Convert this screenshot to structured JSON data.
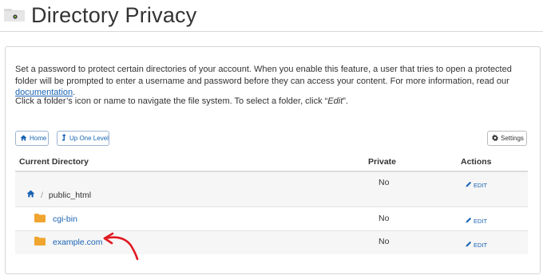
{
  "header": {
    "title": "Directory Privacy",
    "icon": "folder-eye-icon"
  },
  "description": {
    "text": "Set a password to protect certain directories of your account. When you enable this feature, a user that tries to open a protected folder will be prompted to enter a username and password before they can access your content. For more information, read our ",
    "link_label": "documentation",
    "text_end": "."
  },
  "instruction": {
    "text": "Click a folder’s icon or name to navigate the file system. To select a folder, click “",
    "emphasis": "Edit",
    "text_end": "”."
  },
  "toolbar": {
    "home_label": "Home",
    "home_icon": "home-icon",
    "up_label": "Up One Level",
    "up_icon": "level-up-icon",
    "settings_label": "Settings",
    "settings_icon": "gear-icon"
  },
  "table": {
    "headers": {
      "directory": "Current Directory",
      "private": "Private",
      "actions": "Actions"
    },
    "current": {
      "separator": "/",
      "path": "public_html",
      "private": "No",
      "action": "EDIT"
    },
    "rows": [
      {
        "name": "cgi-bin",
        "private": "No",
        "action": "EDIT"
      },
      {
        "name": "example.com",
        "private": "No",
        "action": "EDIT"
      }
    ]
  },
  "colors": {
    "link": "#1a64b4",
    "folder": "#f0a530",
    "annotation_arrow": "#e0191f",
    "row_stripe": "#f6f6f6"
  }
}
